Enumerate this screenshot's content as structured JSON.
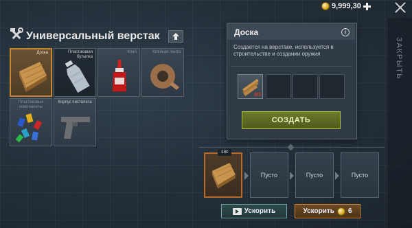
{
  "currency": {
    "value": "9,999,30",
    "icon": "coin-icon"
  },
  "header": {
    "title": "Универсальный верстак",
    "close_label": "ЗАКРЫТЬ"
  },
  "recipes": [
    {
      "label": "Доска",
      "icon": "wood-plank-icon",
      "selected": true
    },
    {
      "label": "Пластиковая бутылка",
      "icon": "plastic-bottle-icon"
    },
    {
      "label": "Клей",
      "icon": "glue-icon"
    },
    {
      "label": "Клейкая лента",
      "icon": "tape-icon"
    },
    {
      "label": "Пластиковые компоненты",
      "icon": "plastic-components-icon"
    },
    {
      "label": "Корпус пистолета",
      "icon": "pistol-frame-icon"
    }
  ],
  "detail": {
    "title": "Доска",
    "description": "Создается на верстаке, используется в строительстве и создании оружия",
    "ingredient_count": "0/3",
    "create_label": "СОЗДАТЬ"
  },
  "queue": {
    "time": "13с",
    "slots": [
      "Пусто",
      "Пусто",
      "Пусто"
    ],
    "speedup_video_label": "Ускорить",
    "speedup_gold_label": "Ускорить",
    "speedup_gold_cost": "6"
  },
  "colors": {
    "accent_orange": "#c8862e",
    "create_green": "#b3c24a",
    "count_red": "#d83a2a"
  }
}
